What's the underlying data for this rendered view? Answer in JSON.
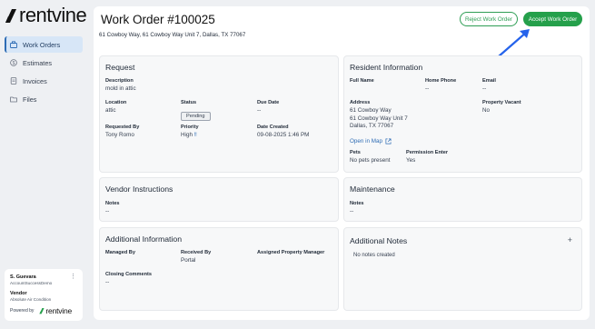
{
  "brand": {
    "name": "rentvine"
  },
  "sidebar": {
    "items": [
      {
        "label": "Work Orders",
        "icon": "toolbox-icon",
        "active": true
      },
      {
        "label": "Estimates",
        "icon": "dollar-circle-icon",
        "active": false
      },
      {
        "label": "Invoices",
        "icon": "document-icon",
        "active": false
      },
      {
        "label": "Files",
        "icon": "folder-icon",
        "active": false
      }
    ]
  },
  "user": {
    "name": "S. Guevara",
    "account": "AccountSuccessDemo",
    "vendor_label": "Vendor",
    "vendor_name": "Absolute Air Condition",
    "powered_by": "Powered by",
    "powered_brand": "rentvine"
  },
  "header": {
    "title": "Work Order #100025",
    "address": "61 Cowboy Way, 61 Cowboy Way Unit 7, Dallas, TX 77067",
    "reject_label": "Reject Work Order",
    "accept_label": "Accept Work Order"
  },
  "request": {
    "title": "Request",
    "description_label": "Description",
    "description": "mold in attic",
    "location_label": "Location",
    "location": "attic",
    "status_label": "Status",
    "status": "Pending",
    "due_label": "Due Date",
    "due": "--",
    "requested_by_label": "Requested By",
    "requested_by": "Tony Romo",
    "priority_label": "Priority",
    "priority": "High",
    "created_label": "Date Created",
    "created": "09-08-2025 1:46 PM"
  },
  "resident": {
    "title": "Resident Information",
    "full_name_label": "Full Name",
    "full_name": "",
    "home_phone_label": "Home Phone",
    "home_phone": "--",
    "email_label": "Email",
    "email": "--",
    "address_label": "Address",
    "address_line1": "61 Cowboy Way",
    "address_line2": "61 Cowboy Way Unit 7",
    "address_line3": "Dallas, TX 77067",
    "map_link": "Open in Map",
    "vacant_label": "Property Vacant",
    "vacant": "No",
    "pets_label": "Pets",
    "pets": "No pets present",
    "permission_label": "Permission Enter",
    "permission": "Yes"
  },
  "vendor_instructions": {
    "title": "Vendor Instructions",
    "notes_label": "Notes",
    "notes": "--"
  },
  "maintenance": {
    "title": "Maintenance",
    "notes_label": "Notes",
    "notes": "--"
  },
  "additional_info": {
    "title": "Additional Information",
    "managed_by_label": "Managed By",
    "managed_by": "",
    "received_by_label": "Received By",
    "received_by": "Portal",
    "assigned_pm_label": "Assigned Property Manager",
    "assigned_pm": "",
    "closing_label": "Closing Comments",
    "closing": "--"
  },
  "additional_notes": {
    "title": "Additional Notes",
    "empty": "No notes created"
  },
  "colors": {
    "accent_green": "#25a04b",
    "link_blue": "#2f6db5",
    "active_nav_bg": "#d7e6f7"
  }
}
